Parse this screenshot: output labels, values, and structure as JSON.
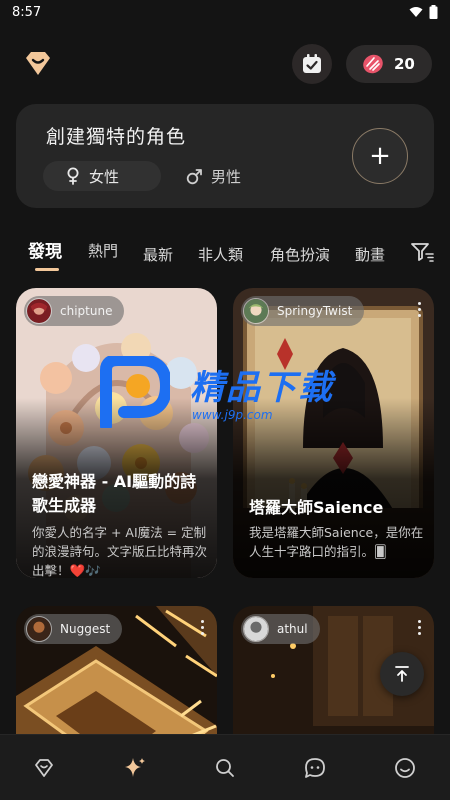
{
  "status_bar": {
    "time": "8:57"
  },
  "header": {
    "gem_count": "20"
  },
  "create": {
    "title": "創建獨特的角色",
    "female_label": "女性",
    "male_label": "男性",
    "add_symbol": "+"
  },
  "tabs": [
    "發現",
    "熱門",
    "最新",
    "非人類",
    "角色扮演",
    "動畫"
  ],
  "cards": [
    {
      "author": "chiptune",
      "title": "戀愛神器 - AI驅動的詩歌生成器",
      "description": "你愛人的名字 + AI魔法 = 定制的浪漫詩句。文字版丘比特再次出擊！❤️🎶"
    },
    {
      "author": "SpringyTwist",
      "title": "塔羅大師Saience",
      "description": "我是塔羅大師Saience，是你在人生十字路口的指引。🂠"
    },
    {
      "author": "Nuggest",
      "title": "",
      "description": ""
    },
    {
      "author": "athul",
      "title": "",
      "description": ""
    }
  ],
  "watermark": {
    "text": "精品下载",
    "url": "www.j9p.com"
  },
  "colors": {
    "background": "#141414",
    "accent": "#f2c79a",
    "card": "#262626"
  },
  "icons": {
    "nav": [
      "heart-diamond-icon",
      "sparkle-icon",
      "search-icon",
      "chat-icon",
      "smile-icon"
    ]
  }
}
